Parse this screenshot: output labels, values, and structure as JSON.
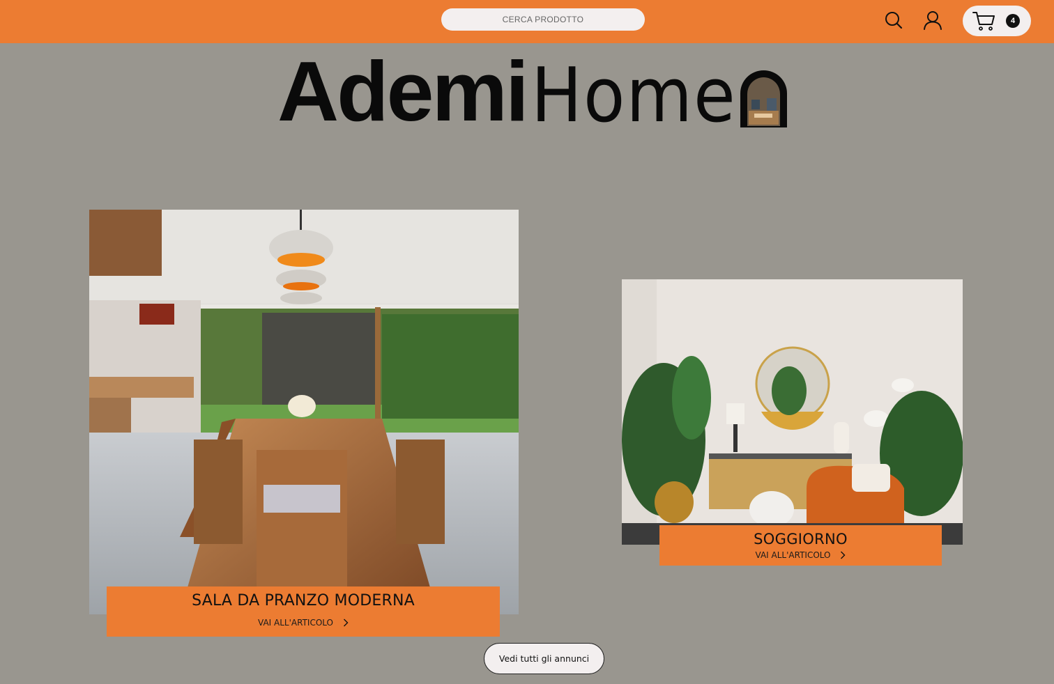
{
  "header": {
    "search": {
      "placeholder": "CERCA PRODOTTO",
      "value": ""
    },
    "icons": {
      "search": "search-icon",
      "account": "user-icon",
      "cart": "cart-icon"
    },
    "cart_count": "4",
    "colors": {
      "bar": "#ec7c32",
      "pill": "#f3efef",
      "badge": "#111111"
    }
  },
  "brand": {
    "name_bold": "Ademi",
    "name_light": "Home",
    "mark": "arched-window-logo"
  },
  "articles": [
    {
      "title": "SALA DA PRANZO MODERNA",
      "link_label": "VAI ALL'ARTICOLO",
      "image": "dining-room-photo"
    },
    {
      "title": "SOGGIORNO",
      "link_label": "VAI ALL'ARTICOLO",
      "image": "living-room-photo"
    }
  ],
  "cta": {
    "label": "Vedi tutti gli annunci"
  },
  "colors": {
    "background": "#99968f",
    "accent": "#ec7c32"
  }
}
